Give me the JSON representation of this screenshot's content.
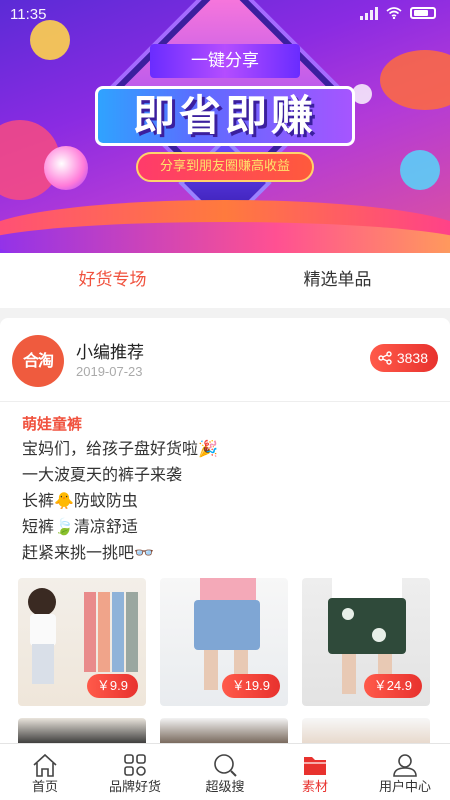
{
  "status": {
    "time": "11:35"
  },
  "banner": {
    "top_label": "一键分享",
    "headline": "即省即赚",
    "subtitle": "分享到朋友圈赚高收益"
  },
  "tabs": [
    {
      "label": "好货专场",
      "active": true
    },
    {
      "label": "精选单品",
      "active": false
    }
  ],
  "post": {
    "avatar_text": "合淘",
    "author": "小编推荐",
    "date": "2019-07-23",
    "share_count": "3838",
    "title": "萌娃童裤",
    "lines": [
      "宝妈们，给孩子盘好货啦🎉",
      "一大波夏天的裤子来袭",
      "长裤🐥防蚊防虫",
      "短裤🍃清凉舒适",
      "赶紧来挑一挑吧👓"
    ],
    "products": [
      {
        "price": "￥9.9"
      },
      {
        "price": "￥19.9"
      },
      {
        "price": "￥24.9"
      }
    ]
  },
  "nav": [
    {
      "label": "首页",
      "icon": "home-icon",
      "active": false
    },
    {
      "label": "品牌好货",
      "icon": "grid-icon",
      "active": false
    },
    {
      "label": "超级搜",
      "icon": "search-icon",
      "active": false
    },
    {
      "label": "素材",
      "icon": "folder-icon",
      "active": true
    },
    {
      "label": "用户中心",
      "icon": "user-icon",
      "active": false
    }
  ],
  "colors": {
    "accent": "#e8322e",
    "tab_active": "#f0523e"
  }
}
